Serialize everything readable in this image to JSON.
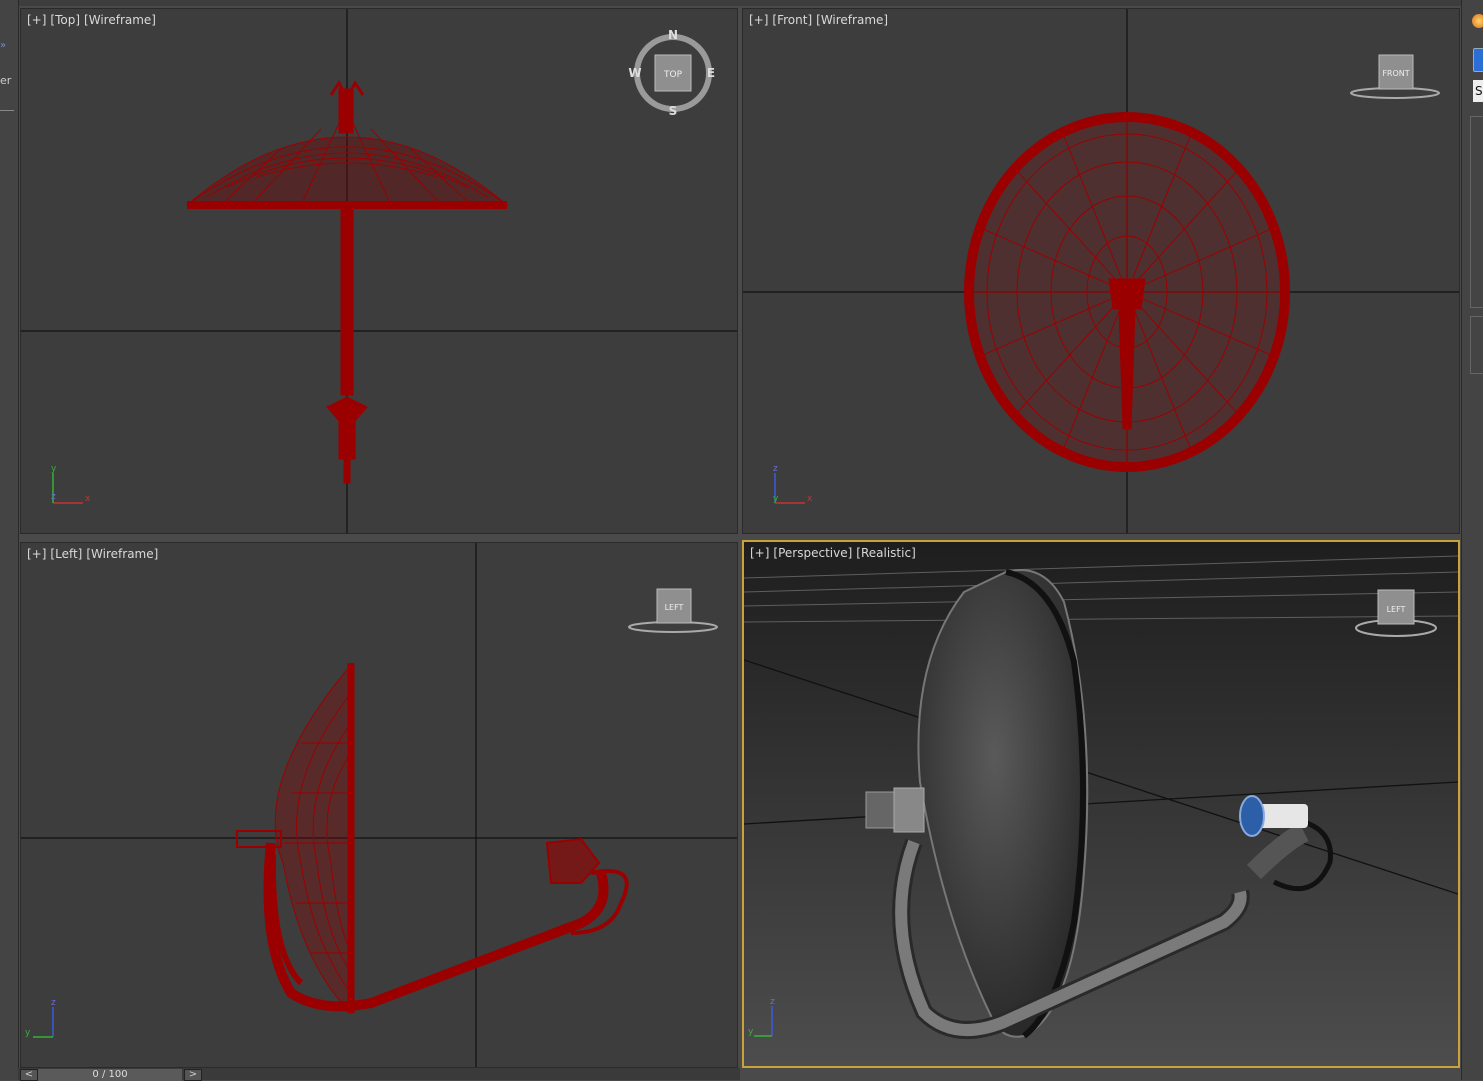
{
  "viewports": {
    "top": {
      "plus": "[+]",
      "view": "[Top]",
      "mode": "[Wireframe]"
    },
    "front": {
      "plus": "[+]",
      "view": "[Front]",
      "mode": "[Wireframe]"
    },
    "left": {
      "plus": "[+]",
      "view": "[Left]",
      "mode": "[Wireframe]"
    },
    "persp": {
      "plus": "[+]",
      "view": "[Perspective]",
      "mode": "[Realistic]"
    }
  },
  "viewcube": {
    "top_face": "TOP",
    "front_face": "FRONT",
    "left_face": "LEFT",
    "compass": {
      "n": "N",
      "s": "S",
      "e": "E",
      "w": "W"
    }
  },
  "axes": {
    "x": "x",
    "y": "y",
    "z": "z"
  },
  "timeline": {
    "frame": "0 / 100",
    "prev": "<",
    "next": ">"
  },
  "side_panel": {
    "field_text": "S",
    "left_text": "er",
    "left_chevron": "»"
  },
  "colors": {
    "wire": "#9b0000",
    "active_border": "#c9a23a",
    "viewport_bg": "#3d3d3d"
  }
}
